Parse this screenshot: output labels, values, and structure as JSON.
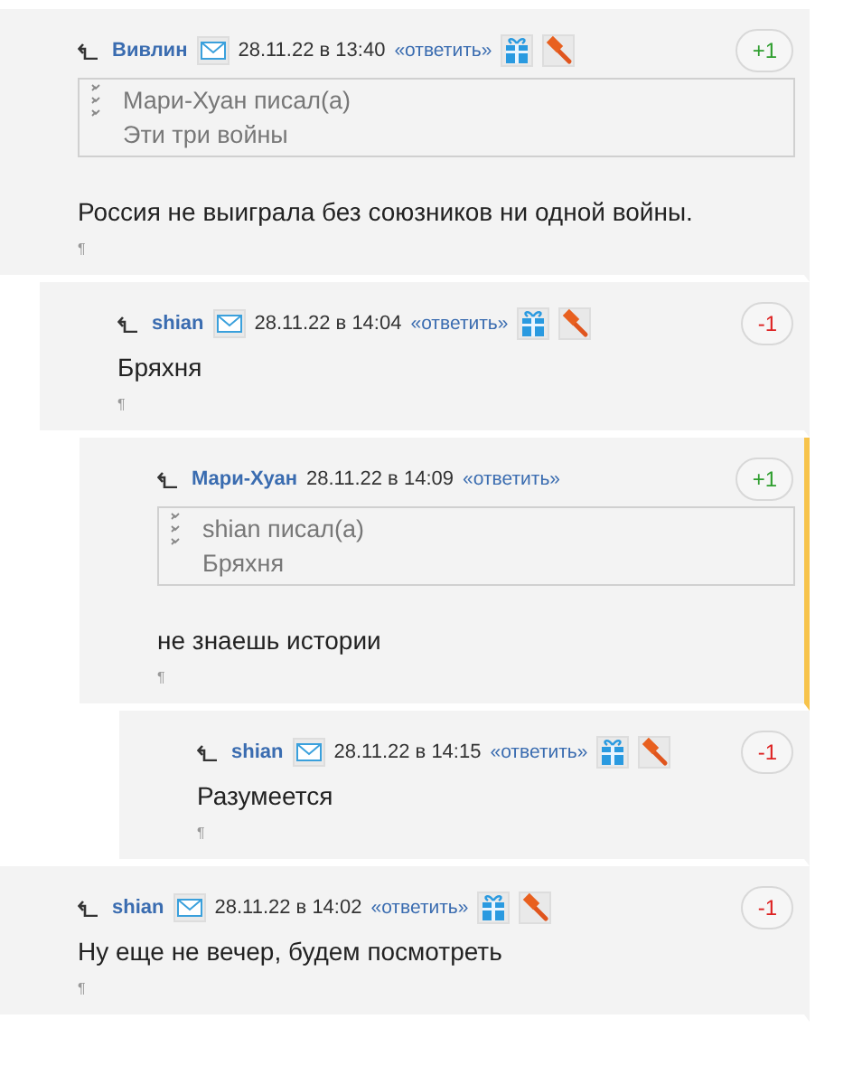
{
  "comments": [
    {
      "author": "Вивлин",
      "mail_icon": true,
      "date": "28.11.22 в 13:40",
      "reply": "«ответить»",
      "gift_icon": true,
      "hammer_icon": true,
      "vote": {
        "text": "+1",
        "color": "#2e9e2e"
      },
      "highlighted": false,
      "quote": {
        "author_line": "Мари-Хуан писал(а)",
        "text": "Эти три войны"
      },
      "text": "Россия не выиграла без союзников ни одной войны.",
      "pilcrow": "¶",
      "children": [
        {
          "author": "shian",
          "mail_icon": true,
          "date": "28.11.22 в 14:04",
          "reply": "«ответить»",
          "gift_icon": true,
          "hammer_icon": true,
          "vote": {
            "text": "-1",
            "color": "#dd2222"
          },
          "highlighted": false,
          "text": "Бряхня",
          "pilcrow": "¶",
          "children": [
            {
              "author": "Мари-Хуан",
              "mail_icon": false,
              "date": "28.11.22 в 14:09",
              "reply": "«ответить»",
              "gift_icon": false,
              "hammer_icon": false,
              "vote": {
                "text": "+1",
                "color": "#2e9e2e"
              },
              "highlighted": true,
              "quote": {
                "author_line": "shian писал(а)",
                "text": "Бряхня"
              },
              "text": "не знаешь истории",
              "pilcrow": "¶",
              "children": [
                {
                  "author": "shian",
                  "mail_icon": true,
                  "date": "28.11.22 в 14:15",
                  "reply": "«ответить»",
                  "gift_icon": true,
                  "hammer_icon": true,
                  "vote": {
                    "text": "-1",
                    "color": "#dd2222"
                  },
                  "highlighted": false,
                  "text": "Разумеется",
                  "pilcrow": "¶"
                }
              ]
            }
          ]
        }
      ]
    },
    {
      "author": "shian",
      "mail_icon": true,
      "date": "28.11.22 в 14:02",
      "reply": "«ответить»",
      "gift_icon": true,
      "hammer_icon": true,
      "vote": {
        "text": "-1",
        "color": "#dd2222"
      },
      "highlighted": false,
      "text": "Ну еще не вечер, будем посмотреть",
      "pilcrow": "¶"
    }
  ]
}
